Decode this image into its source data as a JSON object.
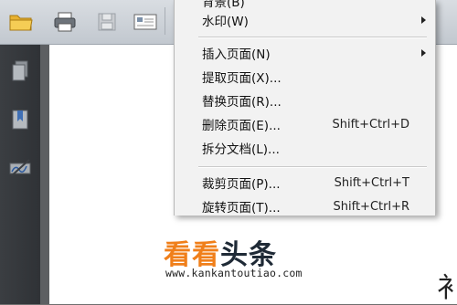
{
  "menu": {
    "items_top": [
      {
        "label": "背景(B)",
        "has_submenu": false
      },
      {
        "label": "水印(W)",
        "has_submenu": true
      }
    ],
    "items_page": [
      {
        "label": "插入页面(N)",
        "has_submenu": true,
        "shortcut": ""
      },
      {
        "label": "提取页面(X)...",
        "has_submenu": false,
        "shortcut": ""
      },
      {
        "label": "替换页面(R)...",
        "has_submenu": false,
        "shortcut": ""
      },
      {
        "label": "删除页面(E)...",
        "has_submenu": false,
        "shortcut": "Shift+Ctrl+D"
      },
      {
        "label": "拆分文档(L)...",
        "has_submenu": false,
        "shortcut": ""
      }
    ],
    "items_edit": [
      {
        "label": "裁剪页面(P)...",
        "shortcut": "Shift+Ctrl+T"
      },
      {
        "label": "旋转页面(T)...",
        "shortcut": "Shift+Ctrl+R"
      }
    ]
  },
  "toolbar": {
    "icons": [
      "open-folder-icon",
      "print-icon",
      "save-icon",
      "email-icon"
    ]
  },
  "leftpane": {
    "icons": [
      "pages-icon",
      "bookmarks-icon",
      "signatures-icon"
    ]
  },
  "watermark": {
    "brand_part1": "看看",
    "brand_part2": "头条",
    "url": "www.kankantoutiao.com"
  },
  "page_edge_text": "衤",
  "colors": {
    "watermark_orange": "#f07f1a",
    "watermark_dark": "#1f2a36",
    "menu_bg": "#f2f2f2"
  }
}
